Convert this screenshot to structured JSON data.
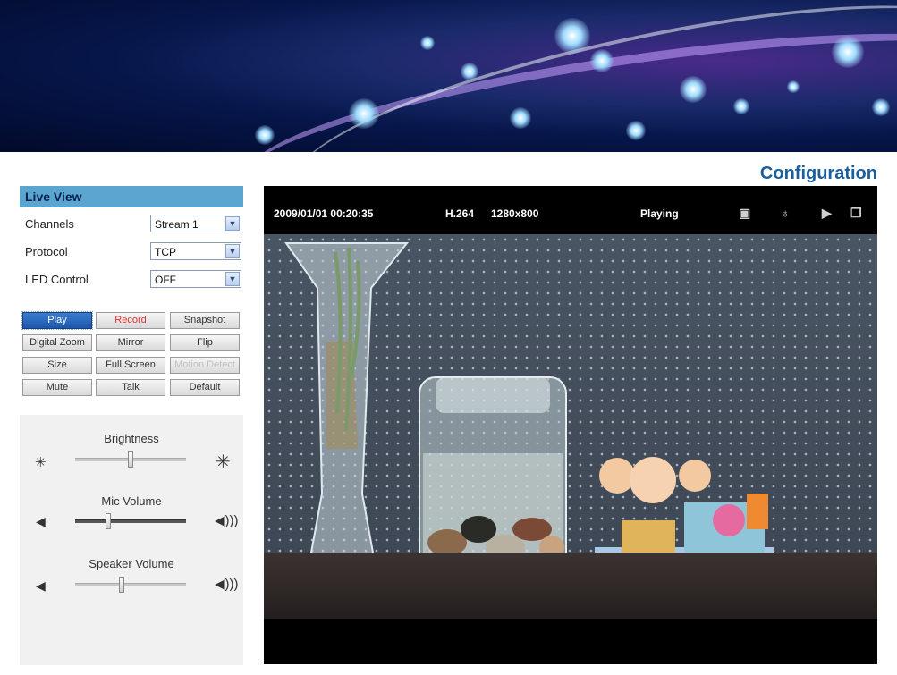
{
  "header": {
    "config_link": "Configuration"
  },
  "live_view": {
    "title": "Live View",
    "settings": [
      {
        "label": "Channels",
        "value": "Stream 1"
      },
      {
        "label": "Protocol",
        "value": "TCP"
      },
      {
        "label": "LED Control",
        "value": "OFF"
      }
    ],
    "buttons": {
      "play": "Play",
      "record": "Record",
      "snapshot": "Snapshot",
      "digital_zoom": "Digital Zoom",
      "mirror": "Mirror",
      "flip": "Flip",
      "size": "Size",
      "full_screen": "Full Screen",
      "motion_detect": "Motion Detect",
      "mute": "Mute",
      "talk": "Talk",
      "default": "Default"
    },
    "sliders": {
      "brightness": {
        "label": "Brightness",
        "level": 0.5
      },
      "mic_volume": {
        "label": "Mic Volume",
        "level": 0.3
      },
      "speaker_volume": {
        "label": "Speaker Volume",
        "level": 0.42
      }
    },
    "icons": {
      "brightness_low": "sun-small-icon",
      "brightness_high": "sun-large-icon",
      "volume_low": "speaker-low-icon",
      "volume_high": "speaker-high-icon"
    }
  },
  "video": {
    "timestamp": "2009/01/01  00:20:35",
    "codec": "H.264",
    "resolution": "1280x800",
    "state": "Playing",
    "icons": [
      "camera-record-icon",
      "microphone-icon",
      "speaker-icon",
      "window-icon"
    ]
  }
}
